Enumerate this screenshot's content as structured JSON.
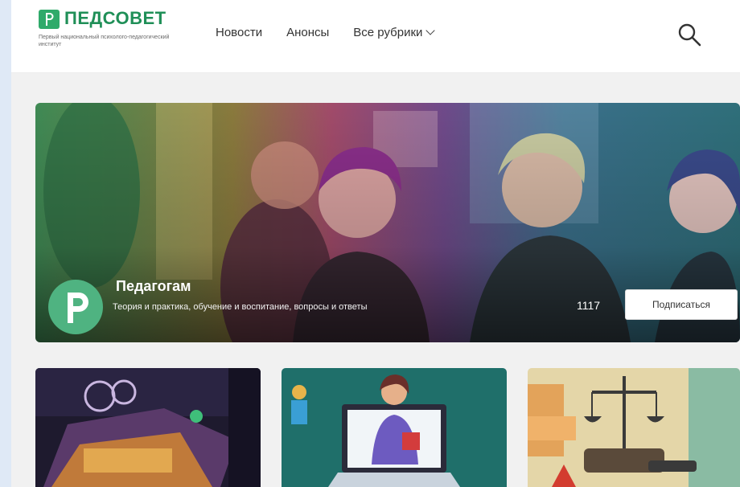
{
  "header": {
    "logo_text": "ПЕДСОВЕТ",
    "logo_sub": "Первый национальный психолого-педагогический институт",
    "nav": [
      {
        "label": "Новости"
      },
      {
        "label": "Анонсы"
      },
      {
        "label": "Все рубрики"
      }
    ]
  },
  "hero": {
    "title": "Педагогам",
    "description": "Теория и практика, обучение и воспитание, вопросы и ответы",
    "count": "1117",
    "subscribe_label": "Подписаться"
  },
  "colors": {
    "brand_green": "#2faa6a",
    "hero_overlay": "#3a6b4a"
  }
}
